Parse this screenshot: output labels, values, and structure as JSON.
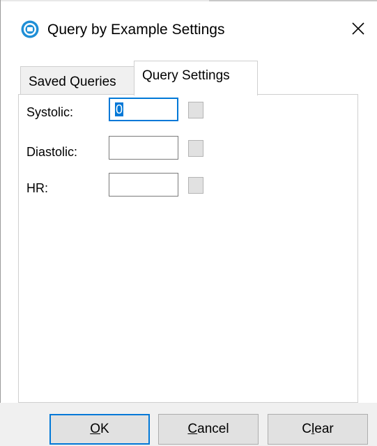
{
  "window": {
    "title": "Query by Example Settings",
    "close_glyph": "✕",
    "icon": "app-icon"
  },
  "tabs": [
    {
      "label": "Saved Queries",
      "active": false
    },
    {
      "label": "Query Settings",
      "active": true
    }
  ],
  "fields": [
    {
      "label": "Systolic:",
      "value": "0",
      "focused": true
    },
    {
      "label": "Diastolic:",
      "value": "",
      "focused": false
    },
    {
      "label": "HR:",
      "value": "",
      "focused": false
    }
  ],
  "buttons": {
    "ok": {
      "mnemonic": "O",
      "rest": "K"
    },
    "cancel": {
      "mnemonic": "C",
      "rest": "ancel"
    },
    "clear": {
      "first": "C",
      "mnemonic": "l",
      "rest": "ear"
    }
  },
  "colors": {
    "accent": "#0078d7",
    "button_face": "#e1e1e1",
    "tab_inactive": "#f0f0f0"
  }
}
